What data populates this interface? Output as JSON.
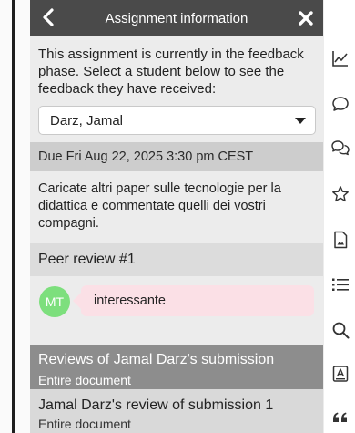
{
  "header": {
    "title": "Assignment information",
    "back_icon": "chevron-left-icon",
    "close_icon": "close-icon"
  },
  "intro_text": "This assignment is currently in the feedback phase. Select a student below to see the feedback they have received:",
  "student_select": {
    "selected": "Darz, Jamal"
  },
  "due_text": "Due Fri Aug 22, 2025 3:30 pm CEST",
  "description": "Caricate altri paper sulle tecnologie per la didattica e commentate quelli dei vostri compagni.",
  "peer_review": {
    "heading": "Peer review #1",
    "comment": {
      "initials": "MT",
      "text": "interessante"
    }
  },
  "reviews_of": {
    "title": "Reviews of Jamal Darz's submission",
    "subtitle": "Entire document"
  },
  "review_by": {
    "title": "Jamal Darz's review of submission 1",
    "subtitle": "Entire document"
  },
  "right_rail_icons": [
    "chart-line-icon",
    "comment-icon",
    "comments-icon",
    "star-icon",
    "file-image-icon",
    "list-icon",
    "search-icon",
    "text-box-icon",
    "quote-icon"
  ],
  "colors": {
    "header_bg": "#4a4a4a",
    "avatar_bg": "#7ddf7d",
    "comment_bubble_bg": "#fbe0e6",
    "reviews_header_bg": "#8d8d8d"
  }
}
